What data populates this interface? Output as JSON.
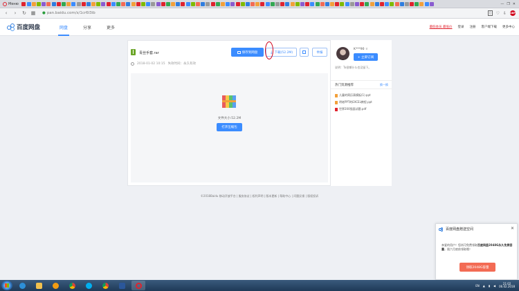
{
  "browser": {
    "menu_label": "Меню",
    "url_host": "pan.baidu.com",
    "url_path": "/s/1cr6I3ib",
    "tab_favicons": [
      "#e0232e",
      "#3b8cff",
      "#f2a03a",
      "#7fba00",
      "#8a5cd0",
      "#f36b54",
      "#2f7ddf",
      "#e0232e",
      "#33a852",
      "#f2a03a",
      "#3b8cff",
      "#999999",
      "#e0232e",
      "#2f7ddf",
      "#f2a03a",
      "#7fba00",
      "#8a5cd0",
      "#e0232e",
      "#3b8cff",
      "#33a852",
      "#f36b54",
      "#2f7ddf",
      "#f2a03a",
      "#e0232e",
      "#7fba00",
      "#3b8cff",
      "#999999",
      "#8a5cd0",
      "#e0232e",
      "#33a852",
      "#f2a03a",
      "#2f7ddf",
      "#e0232e",
      "#3b8cff",
      "#7fba00",
      "#f36b54",
      "#2f7ddf",
      "#999999",
      "#e0232e",
      "#33a852",
      "#f2a03a",
      "#3b8cff",
      "#8a5cd0",
      "#e0232e",
      "#7fba00",
      "#2f7ddf",
      "#f36b54",
      "#f2a03a",
      "#e0232e",
      "#3b8cff",
      "#33a852",
      "#999999",
      "#e0232e",
      "#2f7ddf",
      "#f2a03a",
      "#7fba00",
      "#8a5cd0",
      "#e0232e",
      "#3b8cff",
      "#33a852",
      "#f36b54",
      "#2f7ddf",
      "#f2a03a",
      "#e0232e",
      "#7fba00",
      "#3b8cff",
      "#999999",
      "#8a5cd0",
      "#e0232e",
      "#33a852",
      "#f2a03a",
      "#2f7ddf",
      "#e0232e",
      "#3b8cff",
      "#7fba00",
      "#f36b54",
      "#2f7ddf",
      "#999999",
      "#e0232e",
      "#33a852",
      "#f2a03a",
      "#3b8cff",
      "#8a5cd0"
    ],
    "adblock_label": "ABP"
  },
  "header": {
    "logo_text": "百度网盘",
    "nav": [
      "网盘",
      "分享",
      "更多"
    ],
    "promo": "最低会员 最低价",
    "links": [
      "登录",
      "注册",
      "客户端下载",
      "更多中心"
    ]
  },
  "file": {
    "name": "青丝手套.rar",
    "date": "2018-01-02 10:15",
    "expiry": "失效时间：永久有效",
    "size": "文件大小:52.2M"
  },
  "actions": {
    "save": "保存到网盘",
    "download": "下载(52.2M)",
    "report": "举报",
    "open_archive": "打开压缩包"
  },
  "owner": {
    "username": "K***90",
    "follow": "+ 立即订阅",
    "bio": "说明：Ta很懒什么也没留下。"
  },
  "hot": {
    "title": "热门资源推荐",
    "swap": "换一换",
    "items": [
      {
        "name": "儿童的简历表模板(1).ppt",
        "color": "#f2a03a"
      },
      {
        "name": "明老PPT的EXCEL教程.ppt",
        "color": "#f2a03a"
      },
      {
        "name": "世界200强面试题.pdf",
        "color": "#e0232e"
      }
    ]
  },
  "footer": "©2018Baidu 移动开放平台 | 服务协议 | 权利声明 | 版本更新 | 帮助中心 | 问题反馈 | 版权投诉",
  "popup": {
    "title": "百度网盘赠送空间",
    "line1": "亲爱的用户！您尚可免费领取",
    "line1b": "百度网盘2048G永久免费容量",
    "line2": "，限六月底前领取哦！",
    "button": "领取2048G容量"
  },
  "taskbar": {
    "lang": "EN",
    "time": "21:02",
    "date": "06.02.2018"
  }
}
